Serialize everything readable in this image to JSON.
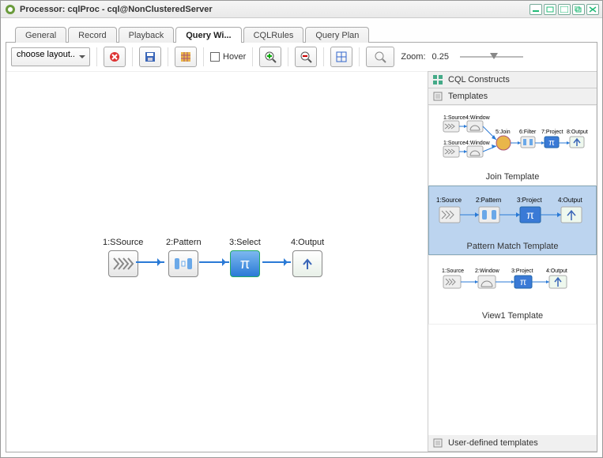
{
  "window": {
    "title": "Processor: cqlProc - cql@NonClusteredServer"
  },
  "tabs": {
    "general": "General",
    "record": "Record",
    "playback": "Playback",
    "queryWizard": "Query Wi...",
    "cqlRules": "CQLRules",
    "queryPlan": "Query Plan"
  },
  "toolbar": {
    "layoutSelect": "choose layout..",
    "hoverLabel": "Hover",
    "zoomLabel": "Zoom:",
    "zoomValue": "0.25"
  },
  "canvasNodes": {
    "n1": "1:SSource",
    "n2": "2:Pattern",
    "n3": "3:Select",
    "n4": "4:Output"
  },
  "sidepanel": {
    "cqlConstructs": "CQL Constructs",
    "templatesHdr": "Templates",
    "userDefined": "User-defined templates",
    "templates": {
      "join": {
        "caption": "Join Template"
      },
      "pattern": {
        "caption": "Pattern Match Template",
        "nodes": {
          "n1": "1:Source",
          "n2": "2:Pattern",
          "n3": "3:Project",
          "n4": "4:Output"
        }
      },
      "view1": {
        "caption": "View1 Template",
        "nodes": {
          "n1": "1:Source",
          "n2": "2:Window",
          "n3": "3:Project",
          "n4": "4:Output"
        }
      }
    }
  },
  "icons": {
    "gear": "gear",
    "minimize": "min",
    "maximize": "max",
    "restore": "rest",
    "close": "close"
  }
}
